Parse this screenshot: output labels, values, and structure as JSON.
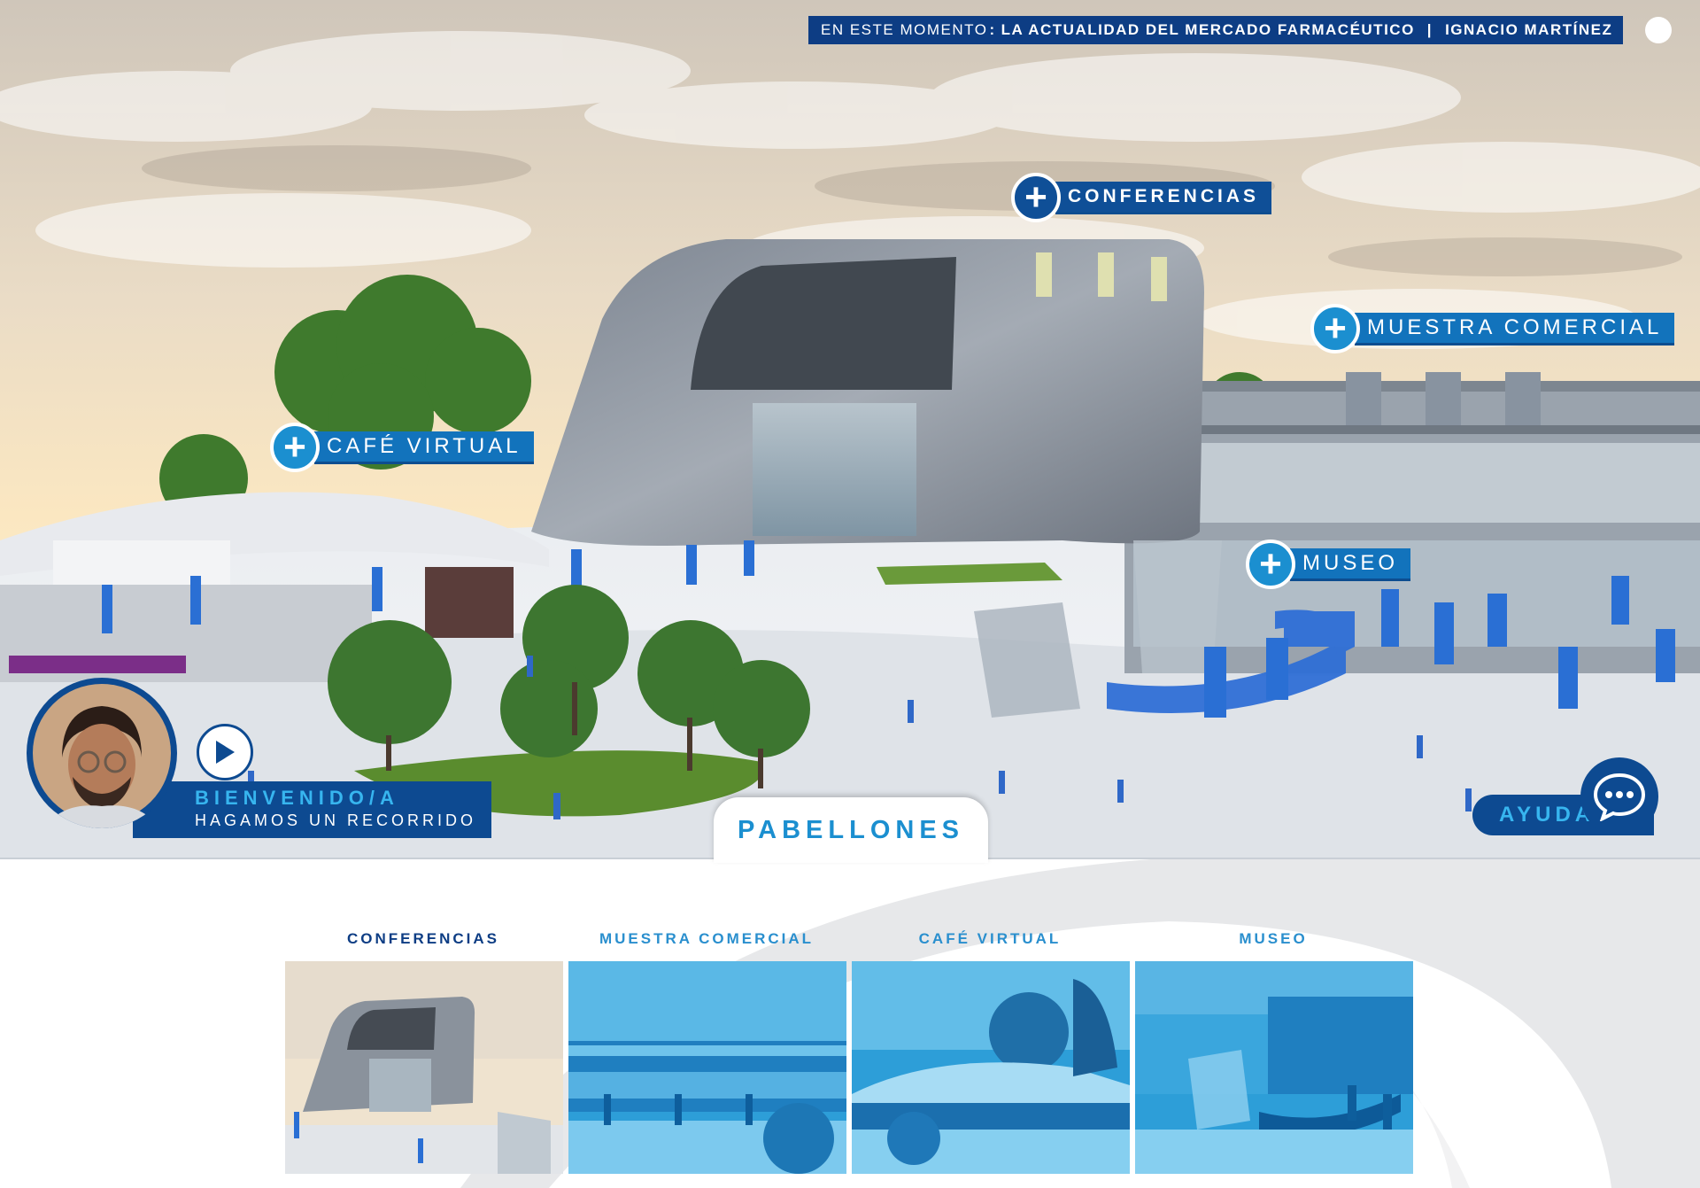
{
  "ticker": {
    "label": "EN ESTE MOMENTO",
    "separator": ":",
    "talk": "LA ACTUALIDAD DEL MERCADO FARMACÉUTICO",
    "divider": "|",
    "speaker": "IGNACIO MARTÍNEZ"
  },
  "hotspots": {
    "conferencias": "CONFERENCIAS",
    "muestra": "MUESTRA COMERCIAL",
    "cafe": "CAFÉ VIRTUAL",
    "museo": "MUSEO"
  },
  "host": {
    "line1": "BIENVENIDO/A",
    "line2": "HAGAMOS UN RECORRIDO"
  },
  "help": {
    "label": "AYUDA"
  },
  "tab": {
    "label": "PABELLONES"
  },
  "pavilions": [
    {
      "name": "CONFERENCIAS",
      "active": true
    },
    {
      "name": "MUESTRA COMERCIAL",
      "active": false
    },
    {
      "name": "CAFÉ VIRTUAL",
      "active": false
    },
    {
      "name": "MUSEO",
      "active": false
    }
  ],
  "colors": {
    "navy": "#0d3d84",
    "blue": "#1273bc",
    "light_blue": "#1b8fd0",
    "accent": "#37b5ef"
  },
  "icons": {
    "plus": "plus-icon",
    "play": "play-icon",
    "chat": "chat-bubble-icon"
  }
}
